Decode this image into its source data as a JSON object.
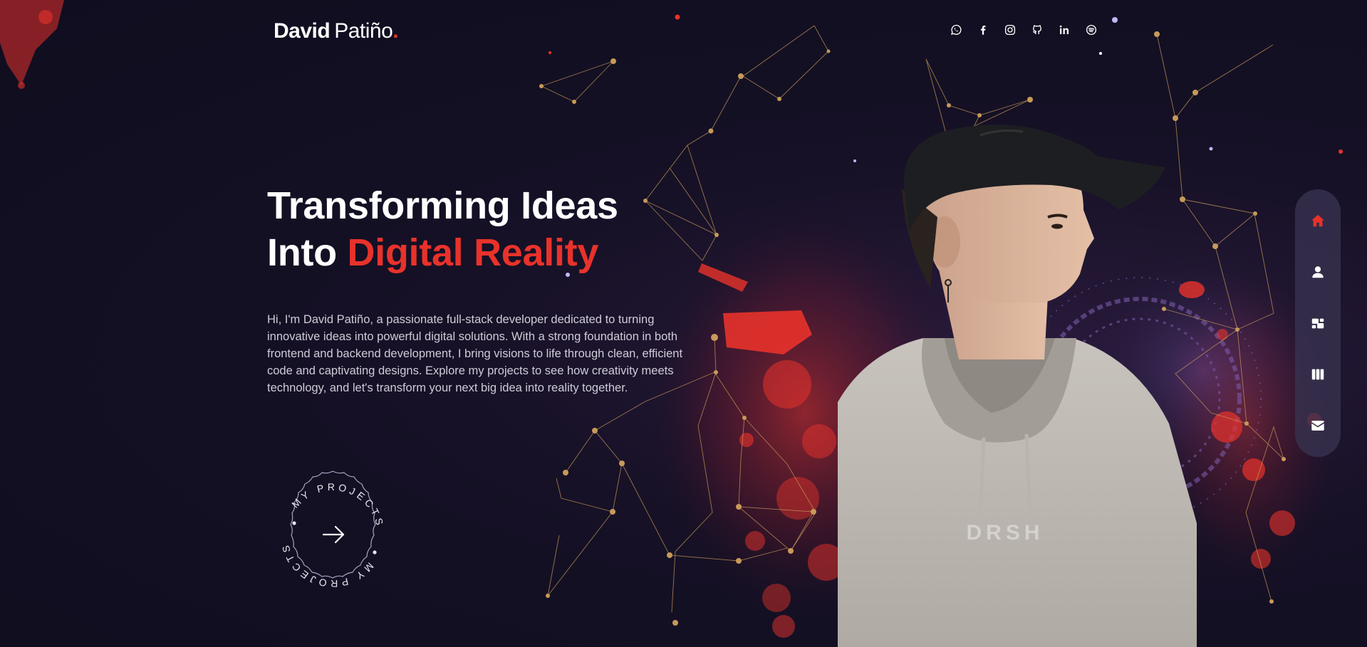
{
  "brand": {
    "first": "David",
    "last": "Patiño",
    "dot": "."
  },
  "colors": {
    "accent": "#e8322b",
    "background": "#120f22",
    "nav_bg": "#3a3452",
    "network_lines": "#c79a5a"
  },
  "socials": [
    {
      "name": "whatsapp-icon"
    },
    {
      "name": "facebook-icon"
    },
    {
      "name": "instagram-icon"
    },
    {
      "name": "github-icon"
    },
    {
      "name": "linkedin-icon"
    },
    {
      "name": "spotify-icon"
    }
  ],
  "hero": {
    "title_line1": "Transforming Ideas",
    "title_line2_prefix": "Into ",
    "title_line2_accent": "Digital Reality",
    "description": "Hi, I'm David Patiño, a passionate full-stack developer dedicated to turning innovative ideas into powerful digital solutions. With a strong foundation in both frontend and backend development, I bring visions to life through clean, efficient code and captivating designs. Explore my projects to see how creativity meets technology, and let's transform your next big idea into reality together."
  },
  "cta": {
    "ring_text": "MY PROJECTS",
    "icon": "arrow-right-icon"
  },
  "nav": [
    {
      "name": "home",
      "icon": "home-icon",
      "active": true
    },
    {
      "name": "about",
      "icon": "user-icon",
      "active": false
    },
    {
      "name": "services",
      "icon": "dashboard-icon",
      "active": false
    },
    {
      "name": "projects",
      "icon": "columns-icon",
      "active": false
    },
    {
      "name": "contact",
      "icon": "envelope-icon",
      "active": false
    }
  ],
  "portrait": {
    "hoodie_text": "DRSH"
  }
}
